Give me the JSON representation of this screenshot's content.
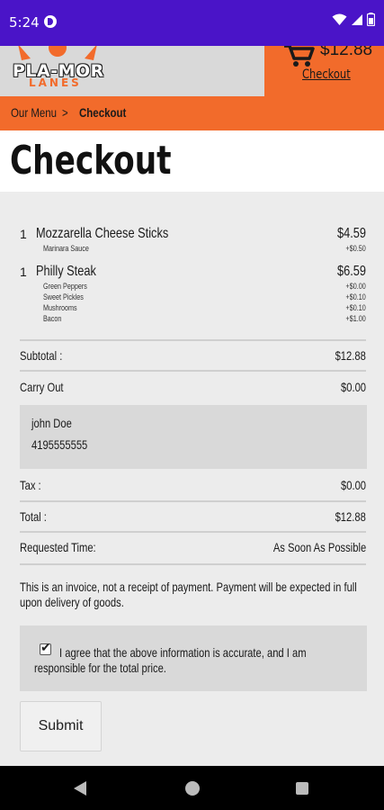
{
  "status_bar": {
    "time": "5:24",
    "icons": [
      "app-notification-icon",
      "wifi-icon",
      "signal-icon",
      "battery-icon"
    ]
  },
  "header": {
    "logo_text": "PLA-MOR",
    "logo_subtext": "LANES",
    "cart_total": "$12.88",
    "cart_link": "Checkout",
    "accent_color": "#f26b2b"
  },
  "breadcrumb": {
    "menu": "Our Menu",
    "separator": ">",
    "current": "Checkout"
  },
  "page_title": "Checkout",
  "order_items": [
    {
      "qty": "1",
      "name": "Mozzarella Cheese Sticks",
      "price": "$4.59",
      "modifiers": [
        {
          "name": "Marinara Sauce",
          "price": "+$0.50"
        }
      ]
    },
    {
      "qty": "1",
      "name": "Philly Steak",
      "price": "$6.59",
      "modifiers": [
        {
          "name": "Green Peppers",
          "price": "+$0.00"
        },
        {
          "name": "Sweet Pickles",
          "price": "+$0.10"
        },
        {
          "name": "Mushrooms",
          "price": "+$0.10"
        },
        {
          "name": "Bacon",
          "price": "+$1.00"
        }
      ]
    }
  ],
  "summary": {
    "subtotal_label": "Subtotal :",
    "subtotal_value": "$12.88",
    "delivery_label": "Carry Out",
    "delivery_value": "$0.00",
    "tax_label": "Tax :",
    "tax_value": "$0.00",
    "total_label": "Total :",
    "total_value": "$12.88",
    "requested_time_label": "Requested Time:",
    "requested_time_value": "As Soon As Possible"
  },
  "customer": {
    "name": "john Doe",
    "phone": "4195555555"
  },
  "invoice_note": "This is an invoice, not a receipt of payment. Payment will be expected in full upon delivery of goods.",
  "agreement": {
    "checked": true,
    "text": "I agree that the above information is accurate, and I am responsible for the total price."
  },
  "submit_label": "Submit"
}
